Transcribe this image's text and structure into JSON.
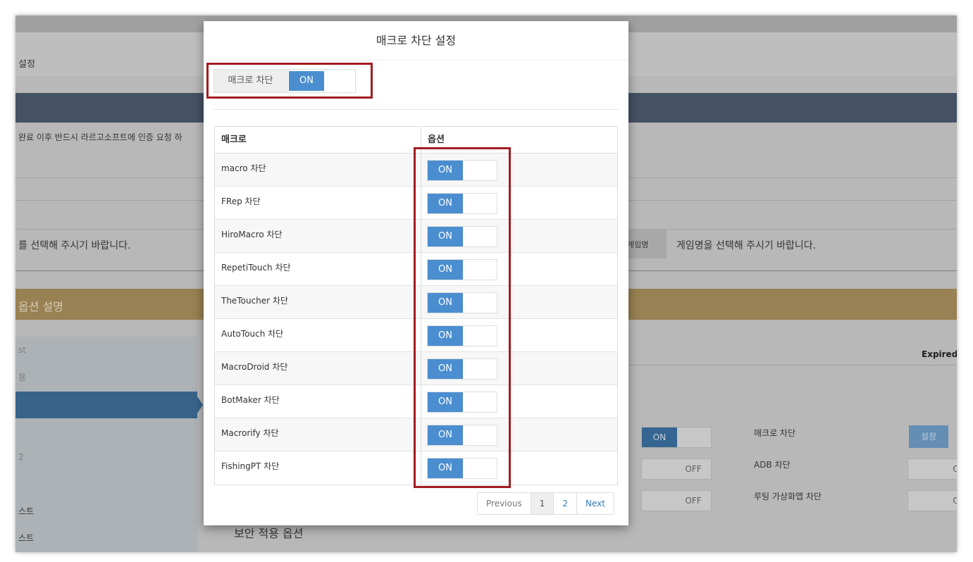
{
  "background": {
    "settings_label": "설정",
    "notice_text": "완료 이후 반드시 라르고소프트에 인증 요청 하",
    "select_prompt_left": "를 선택해 주시기 바랍니다.",
    "game_name_label": "게임명",
    "select_prompt_right": "게임명을 선택해 주시기 바랍니다.",
    "option_desc_title": "옵션 설명",
    "col_st": "st",
    "col_expired": "Expired",
    "side_yong": "용",
    "side_2": "2",
    "side_list1": "스트",
    "side_list2": "스트",
    "security_options_title": "보안 적용 옵션",
    "option_macro_block": "매크로 차단",
    "option_adb_block": "ADB 차단",
    "option_rooting_block": "루팅 가상화앱 차단",
    "setting_button": "설정",
    "toggle_on": "ON",
    "toggle_off": "OFF",
    "toggle_o": "O"
  },
  "modal": {
    "title": "매크로 차단 설정",
    "master_label": "매크로 차단",
    "master_state": "ON",
    "table": {
      "headers": [
        "매크로",
        "옵션"
      ],
      "rows": [
        {
          "name": "macro 차단",
          "state": "ON"
        },
        {
          "name": "FRep 차단",
          "state": "ON"
        },
        {
          "name": "HiroMacro 차단",
          "state": "ON"
        },
        {
          "name": "RepetiTouch 차단",
          "state": "ON"
        },
        {
          "name": "TheToucher 차단",
          "state": "ON"
        },
        {
          "name": "AutoTouch 차단",
          "state": "ON"
        },
        {
          "name": "MacroDroid 차단",
          "state": "ON"
        },
        {
          "name": "BotMaker 차단",
          "state": "ON"
        },
        {
          "name": "Macrorify 차단",
          "state": "ON"
        },
        {
          "name": "FishingPT 차단",
          "state": "ON"
        }
      ]
    },
    "pagination": {
      "previous": "Previous",
      "pages": [
        "1",
        "2"
      ],
      "next": "Next"
    }
  }
}
